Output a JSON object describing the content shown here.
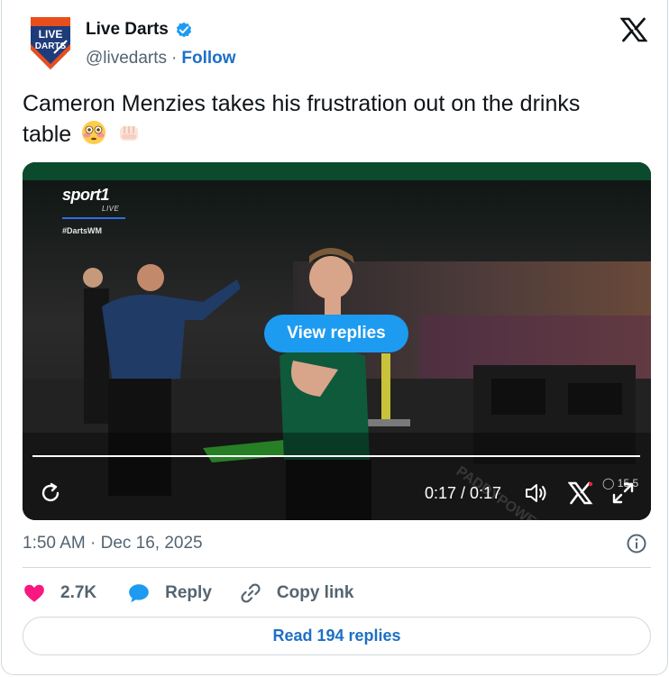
{
  "header": {
    "logo_text_line1": "LIVE",
    "logo_text_line2": "DARTS",
    "display_name": "Live Darts",
    "handle": "@livedarts",
    "separator": "·",
    "follow_label": "Follow"
  },
  "tweet": {
    "text_line1": "Cameron Menzies takes his frustration out on the drinks",
    "text_line2": "table",
    "emojis": [
      "flushed-face-emoji",
      "oncoming-fist-emoji"
    ]
  },
  "video": {
    "broadcaster": "sport1",
    "broadcaster_sub": "LIVE",
    "hashtag": "#DartsWM",
    "overlay_button": "View replies",
    "time_display": "0:17 / 0:17",
    "progress": 1.0,
    "viewers": "15.5"
  },
  "meta": {
    "timestamp": "1:50 AM · Dec 16, 2025"
  },
  "actions": {
    "likes": "2.7K",
    "reply_label": "Reply",
    "copy_link_label": "Copy link"
  },
  "footer": {
    "read_replies_label": "Read 194 replies"
  },
  "colors": {
    "brand_blue": "#1d9bf0",
    "link_blue": "#1d70c4",
    "like_pink": "#f91880",
    "muted": "#536471"
  }
}
